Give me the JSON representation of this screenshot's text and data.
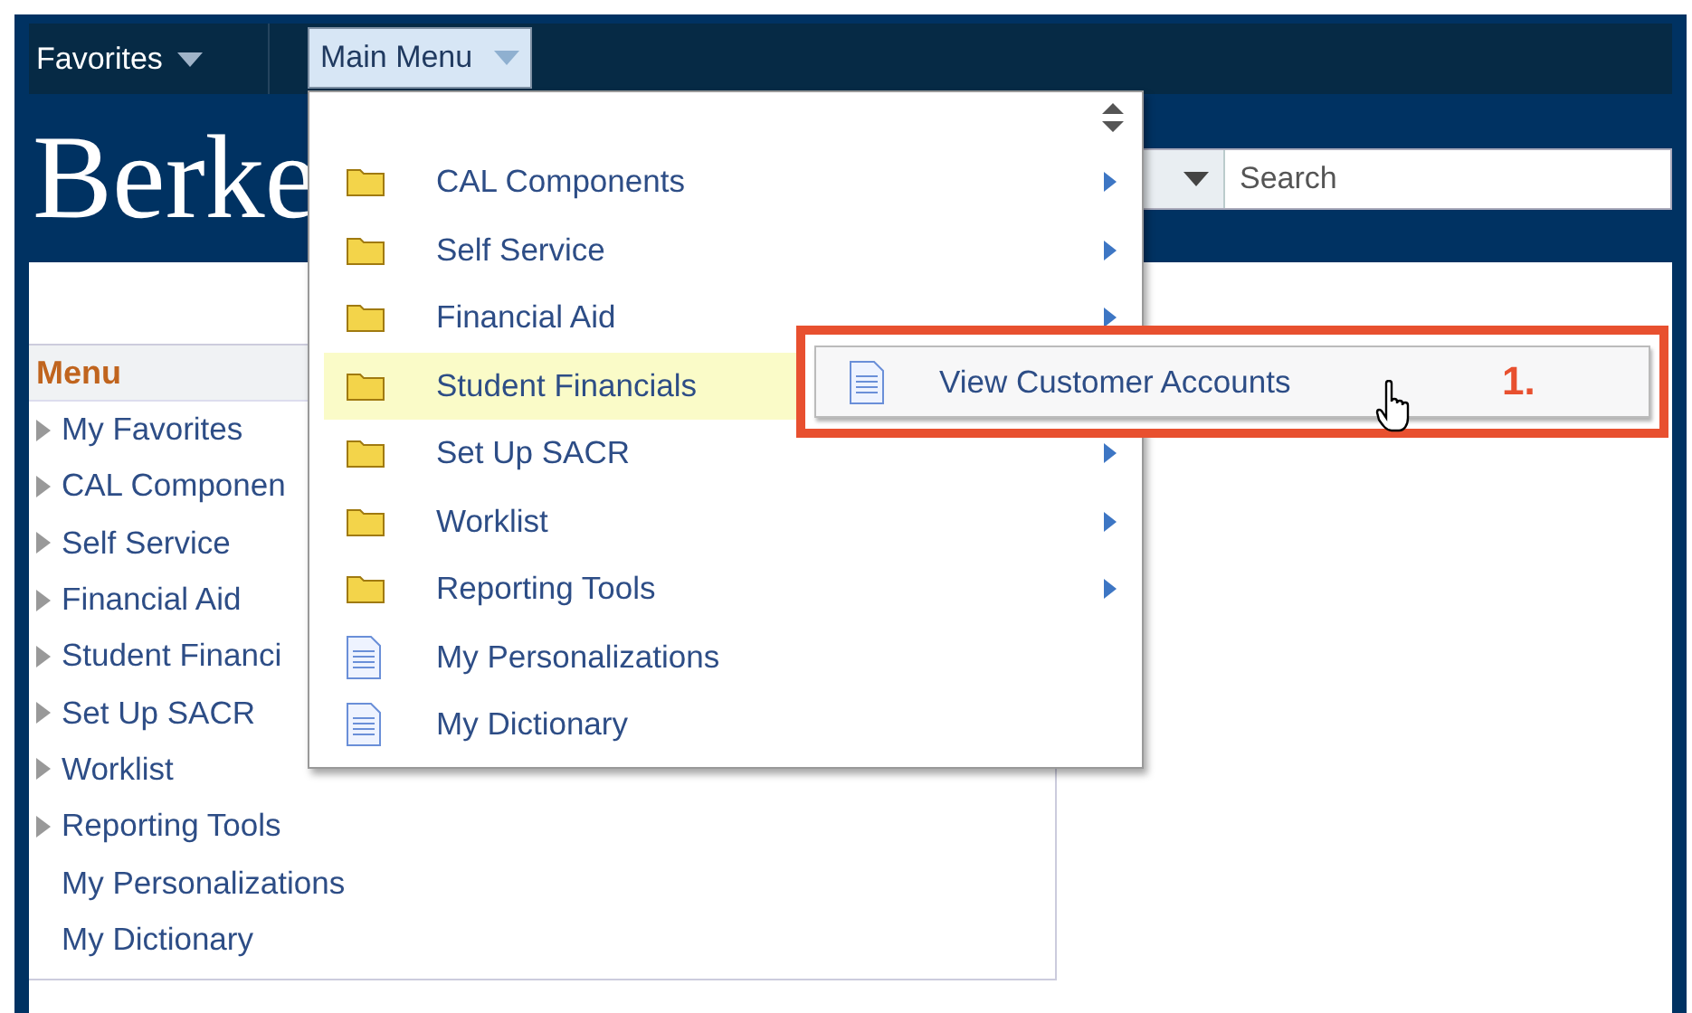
{
  "top_bar": {
    "favorites": "Favorites",
    "main_menu": {
      "label": "Main Menu",
      "selected": true
    }
  },
  "header": {
    "logo": "Berke",
    "search": {
      "placeholder": "Search"
    }
  },
  "menu": {
    "title": "Menu",
    "items": [
      {
        "label": "My Favorites",
        "expandable": true
      },
      {
        "label": "CAL Componen",
        "expandable": true
      },
      {
        "label": "Self Service",
        "expandable": true
      },
      {
        "label": "Financial Aid",
        "expandable": true
      },
      {
        "label": "Student Financi",
        "expandable": true
      },
      {
        "label": "Set Up SACR",
        "expandable": true
      },
      {
        "label": "Worklist",
        "expandable": true
      },
      {
        "label": "Reporting Tools",
        "expandable": true
      },
      {
        "label": "My Personalizations",
        "expandable": false
      },
      {
        "label": "My Dictionary",
        "expandable": false
      }
    ]
  },
  "dropdown": {
    "items": [
      {
        "label": "CAL Components",
        "kind": "folder",
        "has_submenu": true,
        "selected": false
      },
      {
        "label": "Self Service",
        "kind": "folder",
        "has_submenu": true,
        "selected": false
      },
      {
        "label": "Financial Aid",
        "kind": "folder",
        "has_submenu": true,
        "selected": false
      },
      {
        "label": "Student Financials",
        "kind": "folder",
        "has_submenu": false,
        "selected": true
      },
      {
        "label": "Set Up SACR",
        "kind": "folder",
        "has_submenu": true,
        "selected": false
      },
      {
        "label": "Worklist",
        "kind": "folder",
        "has_submenu": true,
        "selected": false
      },
      {
        "label": "Reporting Tools",
        "kind": "folder",
        "has_submenu": true,
        "selected": false
      },
      {
        "label": "My Personalizations",
        "kind": "page",
        "has_submenu": false,
        "selected": false
      },
      {
        "label": "My Dictionary",
        "kind": "page",
        "has_submenu": false,
        "selected": false
      }
    ]
  },
  "submenu": {
    "items": [
      {
        "label": "View Customer Accounts",
        "kind": "page"
      }
    ]
  },
  "callout": {
    "step": "1."
  }
}
